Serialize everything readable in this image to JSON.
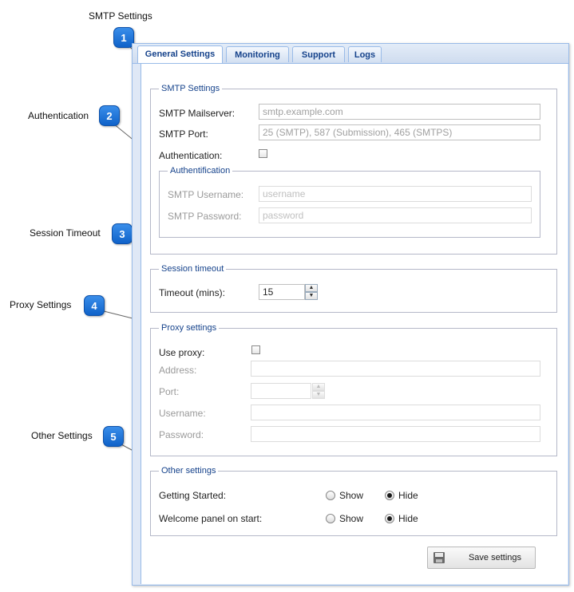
{
  "callouts": [
    {
      "number": "1",
      "label": "SMTP Settings"
    },
    {
      "number": "2",
      "label": "Authentication"
    },
    {
      "number": "3",
      "label": "Session Timeout"
    },
    {
      "number": "4",
      "label": "Proxy Settings"
    },
    {
      "number": "5",
      "label": "Other Settings"
    }
  ],
  "tabs": [
    {
      "label": "General Settings",
      "active": true
    },
    {
      "label": "Monitoring",
      "active": false
    },
    {
      "label": "Support",
      "active": false
    },
    {
      "label": "Logs",
      "active": false
    }
  ],
  "smtp": {
    "legend": "SMTP Settings",
    "mailserver_label": "SMTP Mailserver:",
    "mailserver_placeholder": "smtp.example.com",
    "port_label": "SMTP Port:",
    "port_placeholder": "25 (SMTP), 587 (Submission), 465 (SMTPS)",
    "auth_label": "Authentication:",
    "auth_checked": false,
    "auth_group": {
      "legend": "Authentification",
      "username_label": "SMTP Username:",
      "username_placeholder": "username",
      "password_label": "SMTP Password:",
      "password_placeholder": "password"
    }
  },
  "session": {
    "legend": "Session timeout",
    "timeout_label": "Timeout (mins):",
    "timeout_value": "15"
  },
  "proxy": {
    "legend": "Proxy settings",
    "use_proxy_label": "Use proxy:",
    "use_proxy_checked": false,
    "address_label": "Address:",
    "port_label": "Port:",
    "username_label": "Username:",
    "password_label": "Password:"
  },
  "other": {
    "legend": "Other settings",
    "getting_started_label": "Getting Started:",
    "welcome_label": "Welcome panel on start:",
    "show_label": "Show",
    "hide_label": "Hide",
    "getting_started_value": "Hide",
    "welcome_value": "Hide"
  },
  "save_button_label": "Save settings",
  "colors": {
    "badge": "#1a73e0",
    "legend_text": "#15428b",
    "tab_border": "#99bbe8"
  }
}
